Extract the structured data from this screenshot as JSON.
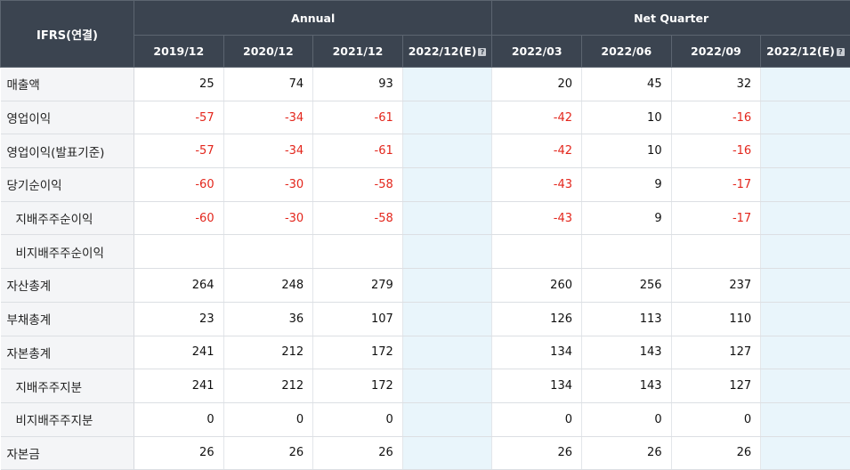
{
  "header": {
    "corner": "IFRS(연결)",
    "annual_label": "Annual",
    "quarter_label": "Net Quarter",
    "estimate_mark": "?",
    "annual_periods": [
      "2019/12",
      "2020/12",
      "2021/12",
      "2022/12(E)"
    ],
    "quarter_periods": [
      "2022/03",
      "2022/06",
      "2022/09",
      "2022/12(E)"
    ]
  },
  "rows": [
    {
      "label": "매출액",
      "sub": false,
      "values": [
        "25",
        "74",
        "93",
        "",
        "20",
        "45",
        "32",
        ""
      ]
    },
    {
      "label": "영업이익",
      "sub": false,
      "values": [
        "-57",
        "-34",
        "-61",
        "",
        "-42",
        "10",
        "-16",
        ""
      ]
    },
    {
      "label": "영업이익(발표기준)",
      "sub": false,
      "values": [
        "-57",
        "-34",
        "-61",
        "",
        "-42",
        "10",
        "-16",
        ""
      ]
    },
    {
      "label": "당기순이익",
      "sub": false,
      "values": [
        "-60",
        "-30",
        "-58",
        "",
        "-43",
        "9",
        "-17",
        ""
      ]
    },
    {
      "label": "지배주주순이익",
      "sub": true,
      "values": [
        "-60",
        "-30",
        "-58",
        "",
        "-43",
        "9",
        "-17",
        ""
      ]
    },
    {
      "label": "비지배주주순이익",
      "sub": true,
      "values": [
        "",
        "",
        "",
        "",
        "",
        "",
        "",
        ""
      ]
    },
    {
      "label": "자산총계",
      "sub": false,
      "values": [
        "264",
        "248",
        "279",
        "",
        "260",
        "256",
        "237",
        ""
      ]
    },
    {
      "label": "부채총계",
      "sub": false,
      "values": [
        "23",
        "36",
        "107",
        "",
        "126",
        "113",
        "110",
        ""
      ]
    },
    {
      "label": "자본총계",
      "sub": false,
      "values": [
        "241",
        "212",
        "172",
        "",
        "134",
        "143",
        "127",
        ""
      ]
    },
    {
      "label": "지배주주지분",
      "sub": true,
      "values": [
        "241",
        "212",
        "172",
        "",
        "134",
        "143",
        "127",
        ""
      ]
    },
    {
      "label": "비지배주주지분",
      "sub": true,
      "values": [
        "0",
        "0",
        "0",
        "",
        "0",
        "0",
        "0",
        ""
      ]
    },
    {
      "label": "자본금",
      "sub": false,
      "values": [
        "26",
        "26",
        "26",
        "",
        "26",
        "26",
        "26",
        ""
      ]
    }
  ],
  "colors": {
    "negative": "#e3261c",
    "header_bg": "#3b4450",
    "estimate_bg": "#e9f5fb"
  }
}
